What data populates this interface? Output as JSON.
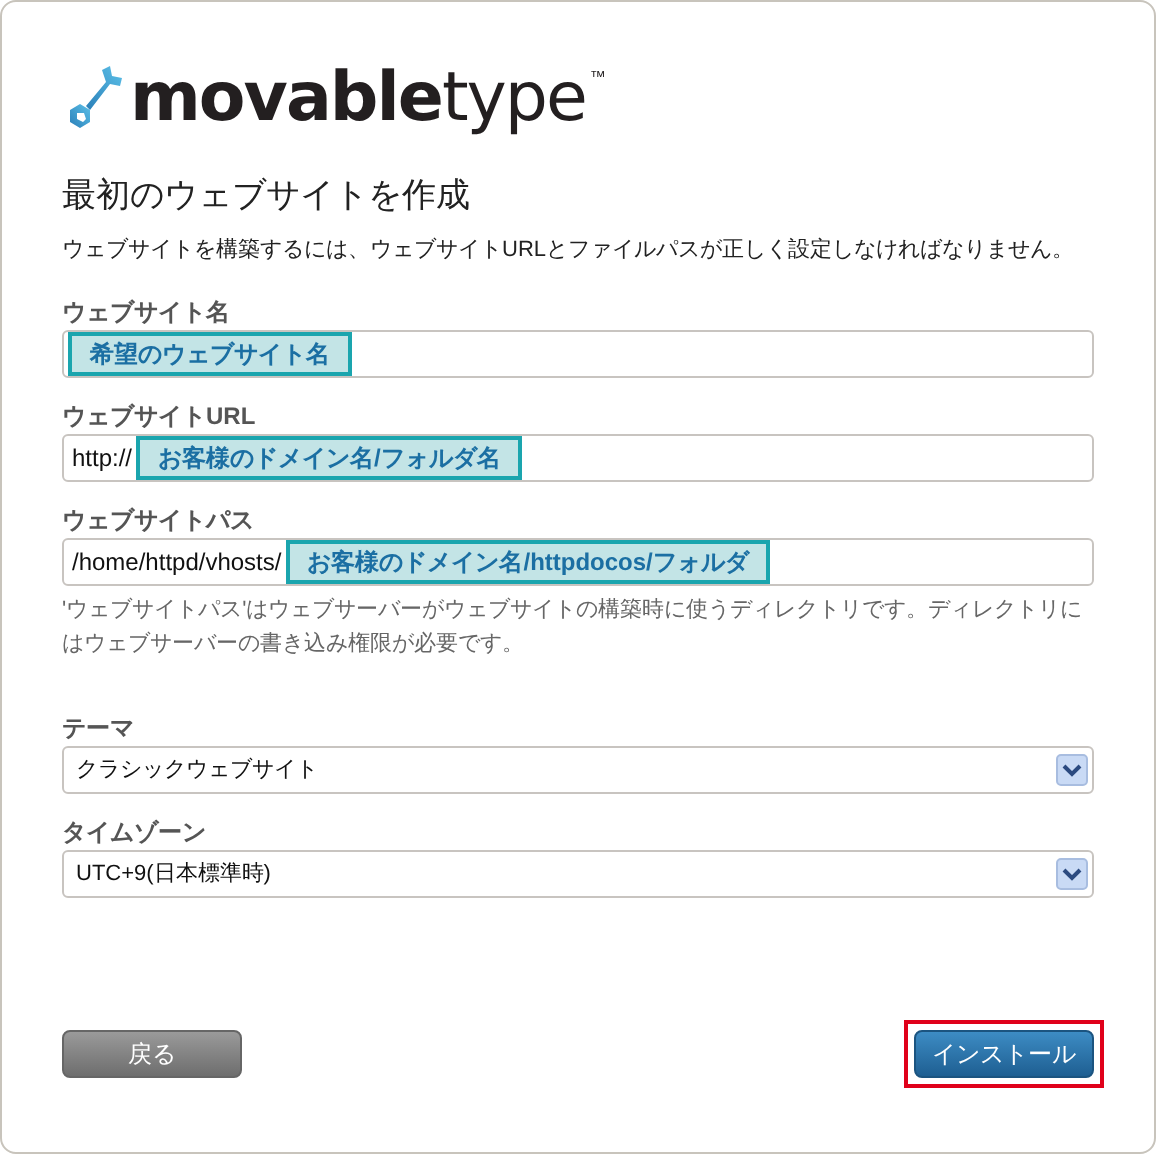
{
  "logo": {
    "text": "**movable**type",
    "trademark": "™"
  },
  "title": "最初のウェブサイトを作成",
  "description": "ウェブサイトを構築するには、ウェブサイトURLとファイルパスが正しく設定しなければなりません。",
  "fields": [
    {
      "kind": "text",
      "label": "ウェブサイト名",
      "highlight": "希望のウェブサイト名"
    },
    {
      "kind": "text",
      "label": "ウェブサイトURL",
      "prefix": "http://",
      "highlight": "お客様のドメイン名/フォルダ名"
    },
    {
      "kind": "text",
      "label": "ウェブサイトパス",
      "prefix": "/home/httpd/vhosts/",
      "highlight": "お客様のドメイン名/httpdocos/フォルダ",
      "help": "'ウェブサイトパス'はウェブサーバーがウェブサイトの構築時に使うディレクトリです。ディレクトリにはウェブサーバーの書き込み権限が必要です。"
    },
    {
      "kind": "select",
      "label": "テーマ",
      "value": "クラシックウェブサイト"
    },
    {
      "kind": "select",
      "label": "タイムゾーン",
      "value": "UTC+9(日本標準時)"
    }
  ],
  "buttons": [
    {
      "kind": "secondary",
      "label": "戻る",
      "highlighted": false
    },
    {
      "kind": "primary",
      "label": "インストール",
      "highlighted": true
    }
  ]
}
